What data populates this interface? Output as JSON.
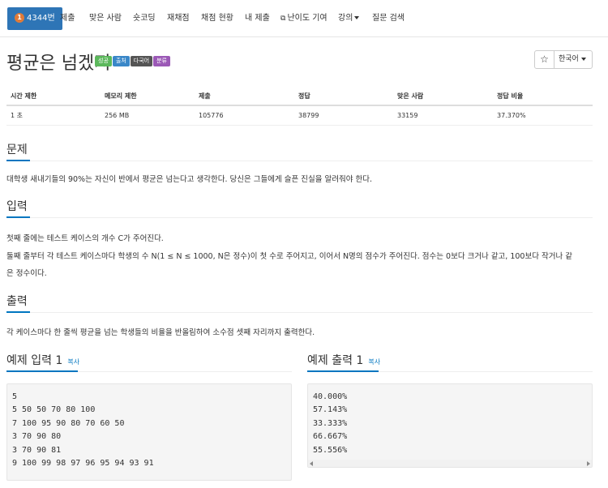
{
  "nav": {
    "problem_number": "4344번",
    "medal_text": "1",
    "tabs": [
      "제출",
      "맞은 사람",
      "숏코딩",
      "재채점",
      "채점 현황",
      "내 제출",
      "난이도 기여",
      "강의",
      "질문 검색"
    ]
  },
  "problem": {
    "title": "평균은 넘겠지",
    "labels": [
      "성공",
      "출처",
      "다국어",
      "분류"
    ]
  },
  "toolbar": {
    "star_icon": "☆",
    "language": "한국어"
  },
  "stats": {
    "headers": [
      "시간 제한",
      "메모리 제한",
      "제출",
      "정답",
      "맞은 사람",
      "정답 비율"
    ],
    "values": [
      "1 초",
      "256 MB",
      "105776",
      "38799",
      "33159",
      "37.370%"
    ]
  },
  "sections": {
    "problem": {
      "title": "문제",
      "text": "대학생 새내기들의 90%는 자신이 반에서 평균은 넘는다고 생각한다. 당신은 그들에게 슬픈 진실을 알려줘야 한다."
    },
    "input": {
      "title": "입력",
      "line1": "첫째 줄에는 테스트 케이스의 개수 C가 주어진다.",
      "line2": "둘째 줄부터 각 테스트 케이스마다 학생의 수 N(1 ≤ N ≤ 1000, N은 정수)이 첫 수로 주어지고, 이어서 N명의 점수가 주어진다. 점수는 0보다 크거나 같고, 100보다 작거나 같",
      "line3": "은 정수이다."
    },
    "output": {
      "title": "출력",
      "text": "각 케이스마다 한 줄씩 평균을 넘는 학생들의 비율을 반올림하여 소수점 셋째 자리까지 출력한다."
    }
  },
  "samples": {
    "input_title": "예제 입력 1",
    "output_title": "예제 출력 1",
    "copy_label": "복사",
    "input_lines": [
      "5",
      "5 50 50 70 80 100",
      "7 100 95 90 80 70 60 50",
      "3 70 90 80",
      "3 70 90 81",
      "9 100 99 98 97 96 95 94 93 91"
    ],
    "output_lines": [
      "40.000%",
      "57.143%",
      "33.333%",
      "66.667%",
      "55.556%"
    ]
  }
}
